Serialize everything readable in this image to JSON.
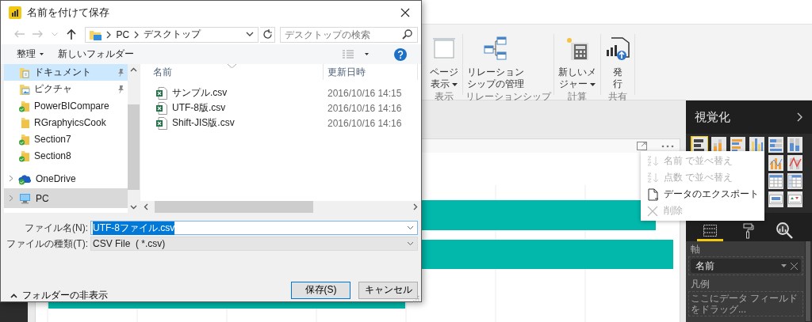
{
  "ribbon": {
    "groups": [
      {
        "label": "表示",
        "buttons": [
          {
            "kind": "page",
            "lines": [
              "ページ",
              "表示"
            ],
            "dropdown": true
          }
        ]
      },
      {
        "label": "リレーションシップ",
        "buttons": [
          {
            "kind": "relations",
            "lines": [
              "リレーション",
              "シップの管理"
            ],
            "dropdown": false
          }
        ]
      },
      {
        "label": "計算",
        "buttons": [
          {
            "kind": "calculator",
            "lines": [
              "新しいメ",
              "ジャー"
            ],
            "dropdown": true
          }
        ]
      },
      {
        "label": "共有",
        "buttons": [
          {
            "kind": "publish",
            "lines": [
              "発",
              "行"
            ],
            "dropdown": false
          }
        ]
      }
    ]
  },
  "context_menu": {
    "items": [
      {
        "kind": "sort",
        "label": "名前 で並べ替え",
        "disabled": true
      },
      {
        "kind": "sort",
        "label": "点数 で並べ替え",
        "disabled": true
      },
      {
        "kind": "export",
        "label": "データのエクスポート",
        "disabled": false
      },
      {
        "kind": "delete",
        "label": "削除",
        "disabled": true
      }
    ]
  },
  "visualizations_pane": {
    "title": "視覚化",
    "visual_types": [
      {
        "kind": "stacked-bar",
        "selected": true
      },
      {
        "kind": "stacked-column",
        "selected": false
      },
      {
        "kind": "clustered-bar",
        "selected": false
      },
      {
        "kind": "clustered-column",
        "selected": false
      },
      {
        "kind": "percent-bar",
        "selected": false
      },
      {
        "kind": "percent-column",
        "selected": false
      },
      {
        "kind": "line-column",
        "selected": false
      },
      {
        "kind": "line-column-red",
        "selected": false
      },
      {
        "kind": "table",
        "selected": false
      },
      {
        "kind": "matrix",
        "selected": false
      },
      {
        "kind": "card",
        "selected": false
      },
      {
        "kind": "kpi",
        "selected": false
      }
    ],
    "tabs": [
      {
        "kind": "fields",
        "selected": true
      },
      {
        "kind": "format",
        "selected": false
      },
      {
        "kind": "analytics",
        "selected": false
      }
    ],
    "sections": [
      {
        "label": "軸",
        "field": "名前"
      },
      {
        "label": "凡例",
        "placeholder": "ここにデータ フィールドをドラッグ..."
      }
    ]
  },
  "dialog": {
    "title": "名前を付けて保存",
    "nav_buttons": [
      {
        "kind": "back",
        "disabled": true
      },
      {
        "kind": "forward",
        "disabled": true
      },
      {
        "kind": "recent",
        "disabled": true
      },
      {
        "kind": "up",
        "disabled": false
      }
    ],
    "breadcrumb": [
      "PC",
      "デスクトップ"
    ],
    "search_placeholder": "デスクトップの検索",
    "toolbar": {
      "organize": "整理",
      "new_folder": "新しいフォルダー"
    },
    "nav": [
      {
        "label": "ドキュメント",
        "kind": "documents",
        "pinned": true,
        "synced": false,
        "selected": true,
        "current": false
      },
      {
        "label": "ピクチャ",
        "kind": "pictures",
        "pinned": true,
        "synced": false,
        "selected": false,
        "current": false
      },
      {
        "label": "PowerBICompare",
        "kind": "folder",
        "pinned": false,
        "synced": true,
        "selected": false,
        "current": false
      },
      {
        "label": "RGraphyicsCook",
        "kind": "folder",
        "pinned": false,
        "synced": false,
        "selected": false,
        "current": false
      },
      {
        "label": "Section7",
        "kind": "folder",
        "pinned": false,
        "synced": true,
        "selected": false,
        "current": false
      },
      {
        "label": "Section8",
        "kind": "folder",
        "pinned": false,
        "synced": true,
        "selected": false,
        "current": false
      },
      {
        "label": "OneDrive",
        "kind": "onedrive",
        "pinned": false,
        "synced": true,
        "selected": false,
        "current": false
      },
      {
        "label": "PC",
        "kind": "pc",
        "pinned": false,
        "synced": false,
        "selected": false,
        "current": true
      }
    ],
    "columns": [
      "名前",
      "更新日時"
    ],
    "files": [
      {
        "name": "サンプル.csv",
        "modified": "2016/10/16 14:15"
      },
      {
        "name": "UTF-8版.csv",
        "modified": "2016/10/16 14:16"
      },
      {
        "name": "Shift-JIS版.csv",
        "modified": "2016/10/16 14:16"
      }
    ],
    "file_name_label": "ファイル名(N):",
    "file_name": "UTF-8ファイル.csv",
    "file_type_label": "ファイルの種類(T):",
    "file_type": "CSV File  ( *.csv)",
    "hide_folders": "フォルダーの非表示",
    "buttons": [
      {
        "label": "保存(S)",
        "default": true
      },
      {
        "label": "キャンセル",
        "default": false
      }
    ]
  }
}
